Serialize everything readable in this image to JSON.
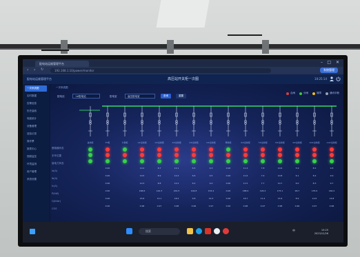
{
  "browser": {
    "tab_title": "配电站运维管理平台",
    "url": "192.168.1.10/power/monitor",
    "corner_button": "系统管理",
    "window_controls": [
      "–",
      "□",
      "✕"
    ]
  },
  "header": {
    "title": "高压站开关柜一次图",
    "brand": "配电站运维管理平台",
    "clock": "10:25:14"
  },
  "sidebar": {
    "items": [
      {
        "label": "一次系统图",
        "active": true
      },
      {
        "label": "实时数据"
      },
      {
        "label": "告警信息"
      },
      {
        "label": "历史曲线"
      },
      {
        "label": "电能统计"
      },
      {
        "label": "设备管理"
      },
      {
        "label": "巡检记录"
      },
      {
        "label": "操作票"
      },
      {
        "label": "报表中心"
      },
      {
        "label": "视频监控"
      },
      {
        "label": "环境监测"
      },
      {
        "label": "用户管理"
      },
      {
        "label": "系统设置"
      }
    ]
  },
  "content": {
    "page_title": "一次系统图",
    "filter_label": "配电站",
    "station_select": "1#配电站",
    "room_label": "配电室",
    "room_select": "高压配电室",
    "query_button": "查询",
    "reset_button": "重置",
    "legend": [
      {
        "label": "合闸",
        "color": "#e53935"
      },
      {
        "label": "分闸",
        "color": "#43c04a"
      },
      {
        "label": "故障",
        "color": "#f4c20d"
      },
      {
        "label": "通讯中断",
        "color": "#9aa3b5"
      }
    ]
  },
  "table": {
    "row_labels": [
      "断路器状态",
      "手车位置",
      "接地刀状态",
      "Ia(A)",
      "Ib(A)",
      "Ic(A)",
      "P(kW)",
      "Q(kVar)",
      "COS"
    ],
    "columns": [
      {
        "name": "进线柜",
        "lamps": [
          "green",
          "green",
          "green"
        ],
        "values": [
          "",
          "",
          "",
          "",
          "",
          ""
        ]
      },
      {
        "name": "PT柜",
        "lamps": [
          "red",
          "red",
          "green"
        ],
        "values": [
          "0.00",
          "0.00",
          "0.00",
          "0.00",
          "0.00",
          "0.00"
        ]
      },
      {
        "name": "计量柜",
        "lamps": [
          "green",
          "red",
          "green"
        ],
        "values": [
          "",
          "",
          "",
          "",
          "",
          ""
        ]
      },
      {
        "name": "1#出线柜",
        "lamps": [
          "red",
          "red",
          "green"
        ],
        "values": [
          "10.2",
          "10.5",
          "10.3",
          "168.6",
          "15.6",
          "0.98"
        ]
      },
      {
        "name": "2#出线柜",
        "lamps": [
          "red",
          "red",
          "green"
        ],
        "values": [
          "8.7",
          "8.9",
          "8.8",
          "142.3",
          "12.1",
          "0.97"
        ]
      },
      {
        "name": "3#出线柜",
        "lamps": [
          "red",
          "red",
          "green"
        ],
        "values": [
          "12.1",
          "12.4",
          "12.2",
          "201.5",
          "18.4",
          "0.98"
        ]
      },
      {
        "name": "4#出线柜",
        "lamps": [
          "red",
          "red",
          "green"
        ],
        "values": [
          "6.5",
          "6.6",
          "6.4",
          "104.8",
          "9.8",
          "0.96"
        ]
      },
      {
        "name": "5#出线柜",
        "lamps": [
          "red",
          "red",
          "green"
        ],
        "values": [
          "9.3",
          "9.5",
          "9.4",
          "153.2",
          "14.3",
          "0.97"
        ]
      },
      {
        "name": "母联柜",
        "lamps": [
          "green",
          "red",
          "green"
        ],
        "values": [
          "0.00",
          "0.00",
          "0.00",
          "0.00",
          "0.00",
          "0.00"
        ]
      },
      {
        "name": "6#出线柜",
        "lamps": [
          "red",
          "red",
          "green"
        ],
        "values": [
          "11.4",
          "11.6",
          "11.5",
          "188.9",
          "16.7",
          "0.98"
        ]
      },
      {
        "name": "7#出线柜",
        "lamps": [
          "red",
          "red",
          "green"
        ],
        "values": [
          "7.8",
          "7.9",
          "7.7",
          "126.4",
          "11.2",
          "0.97"
        ]
      },
      {
        "name": "8#出线柜",
        "lamps": [
          "red",
          "red",
          "green"
        ],
        "values": [
          "10.6",
          "10.8",
          "10.7",
          "175.1",
          "15.9",
          "0.98"
        ]
      },
      {
        "name": "9#出线柜",
        "lamps": [
          "red",
          "red",
          "green"
        ],
        "values": [
          "5.9",
          "6.1",
          "6.0",
          "96.7",
          "8.9",
          "0.96"
        ]
      },
      {
        "name": "10#出线柜",
        "lamps": [
          "red",
          "red",
          "green"
        ],
        "values": [
          "8.2",
          "8.4",
          "8.3",
          "135.6",
          "12.6",
          "0.97"
        ]
      },
      {
        "name": "11#出线柜",
        "lamps": [
          "red",
          "red",
          "green"
        ],
        "values": [
          "9.8",
          "9.9",
          "9.7",
          "160.2",
          "14.8",
          "0.98"
        ]
      }
    ]
  },
  "taskbar": {
    "search_text": "搜索",
    "clock_time": "10:25",
    "clock_date": "2023/12/26",
    "lang": "中"
  },
  "colors": {
    "green": "#38d04a",
    "red": "#ff3b3b",
    "bus": "#3cff6a"
  }
}
